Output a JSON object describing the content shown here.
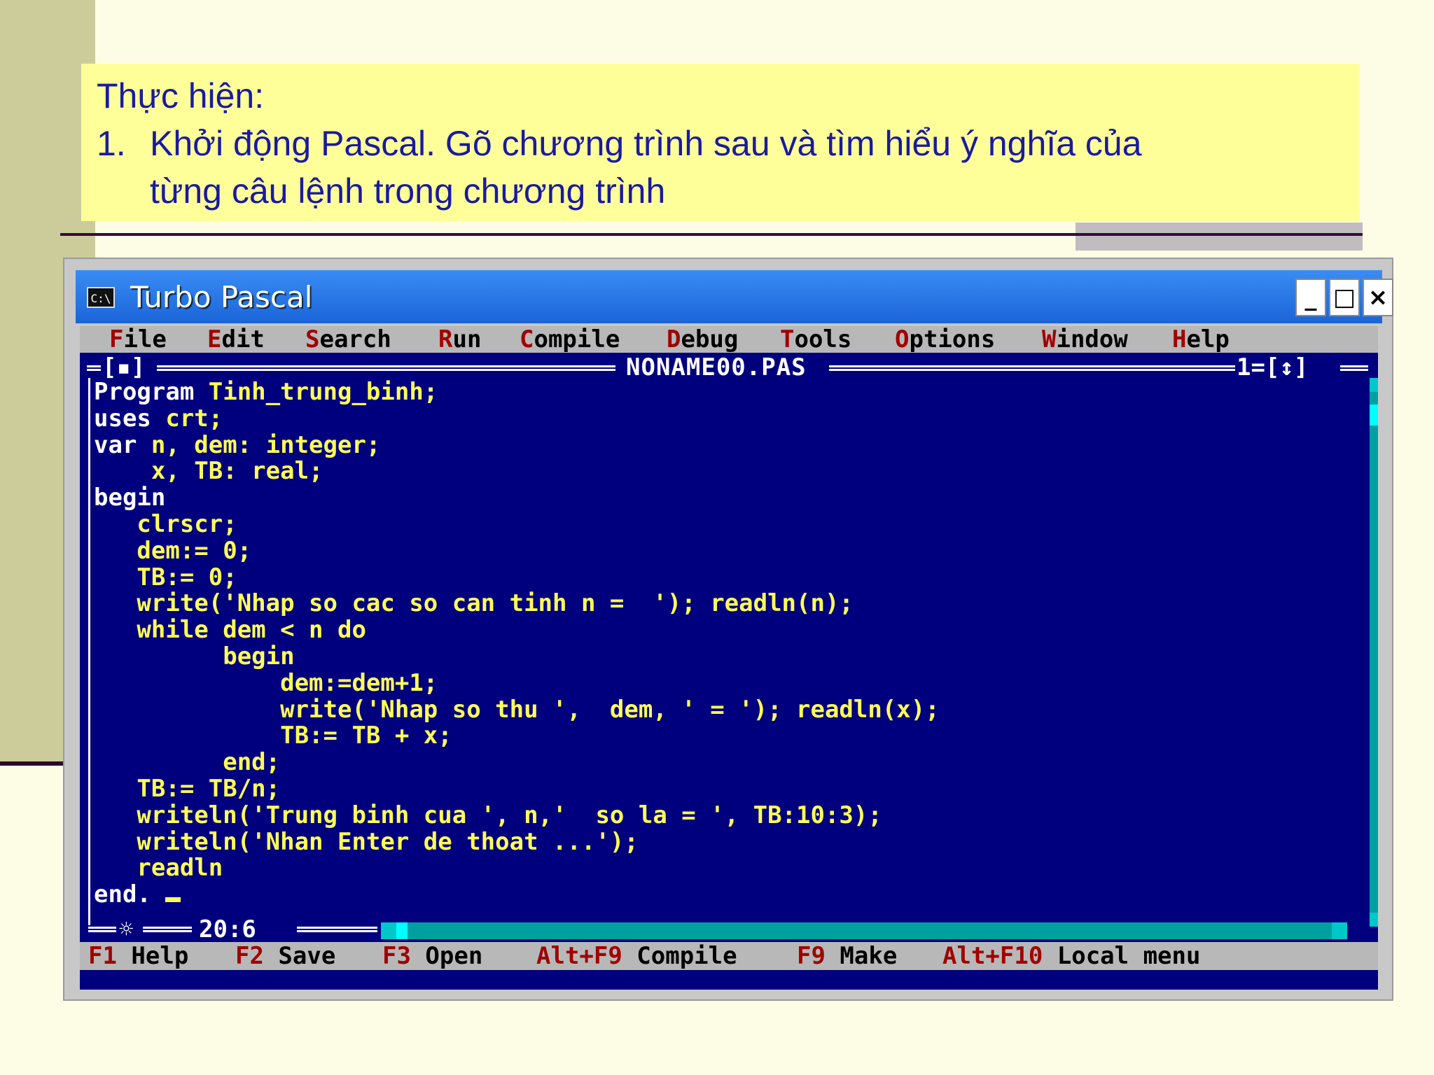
{
  "slide": {
    "heading": "Thực hiện:",
    "step_number": "1.",
    "step_text_line1": "Khởi động Pascal. Gõ chương trình sau và tìm hiểu ý nghĩa của",
    "step_text_line2": "từng câu lệnh trong chương trình"
  },
  "window": {
    "icon_text": "C:\\",
    "title": "Turbo Pascal",
    "min_label": "_",
    "max_label": "□",
    "close_label": "×"
  },
  "menu": [
    {
      "hot": "F",
      "rest": "ile"
    },
    {
      "hot": "E",
      "rest": "dit"
    },
    {
      "hot": "S",
      "rest": "earch"
    },
    {
      "hot": "R",
      "rest": "un"
    },
    {
      "hot": "C",
      "rest": "ompile"
    },
    {
      "hot": "D",
      "rest": "ebug"
    },
    {
      "hot": "T",
      "rest": "ools"
    },
    {
      "hot": "O",
      "rest": "ptions"
    },
    {
      "hot": "W",
      "rest": "indow"
    },
    {
      "hot": "H",
      "rest": "elp"
    }
  ],
  "editor": {
    "close_box": "[▪]",
    "file_name": "NONAME00.PAS",
    "window_number": "1=[↕]",
    "position": "20:6",
    "modified_marker": "☼",
    "code_lines": [
      "Program Tinh_trung_binh;",
      "uses crt;",
      "var n, dem: integer;",
      "    x, TB: real;",
      "begin",
      "   clrscr;",
      "   dem:= 0;",
      "   TB:= 0;",
      "   write('Nhap so cac so can tinh n =  '); readln(n);",
      "   while dem < n do",
      "         begin",
      "             dem:=dem+1;",
      "             write('Nhap so thu ',  dem, ' = '); readln(x);",
      "             TB:= TB + x;",
      "         end;",
      "   TB:= TB/n;",
      "   writeln('Trung binh cua ', n,'  so la = ', TB:10:3);",
      "   writeln('Nhan Enter de thoat ...');",
      "   readln",
      "end."
    ]
  },
  "status": [
    {
      "key": "F1",
      "label": " Help"
    },
    {
      "key": "F2",
      "label": " Save"
    },
    {
      "key": "F3",
      "label": " Open"
    },
    {
      "key": "Alt+F9",
      "label": " Compile"
    },
    {
      "key": "F9",
      "label": " Make"
    },
    {
      "key": "Alt+F10",
      "label": " Local menu"
    }
  ],
  "colors": {
    "editor_bg": "#00007e",
    "code_text": "#ffff55",
    "keyword_text": "#ffffff",
    "hotkey": "#a00000",
    "title_text": "#1a1aa0",
    "title_box": "#ffff99"
  }
}
